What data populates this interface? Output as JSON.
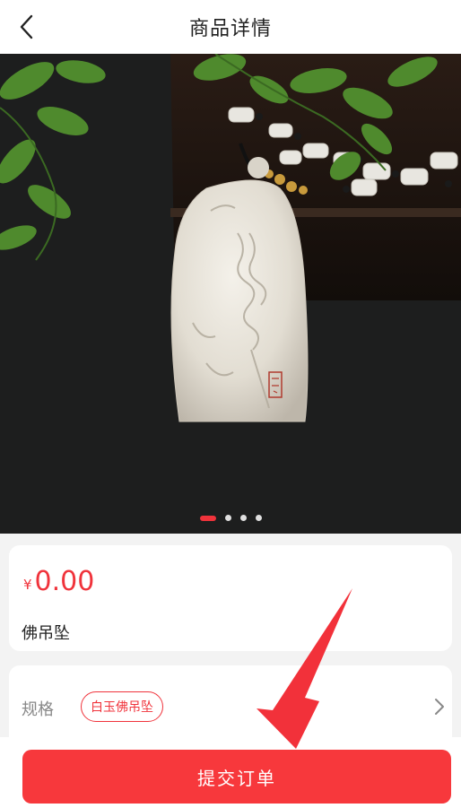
{
  "header": {
    "title": "商品详情",
    "back_icon": "chevron-left-icon"
  },
  "gallery": {
    "image": "white jade Buddha pendant on dark background with green plant",
    "slide_count": 4,
    "active_index": 0
  },
  "product": {
    "currency_symbol": "¥",
    "price": "0.00",
    "name": "佛吊坠"
  },
  "spec": {
    "label": "规格",
    "selected": "白玉佛吊坠",
    "arrow_icon": "chevron-right-icon"
  },
  "action": {
    "submit_label": "提交订单"
  },
  "colors": {
    "accent": "#f0333b",
    "button": "#f7383c",
    "background": "#f3f3f3"
  }
}
